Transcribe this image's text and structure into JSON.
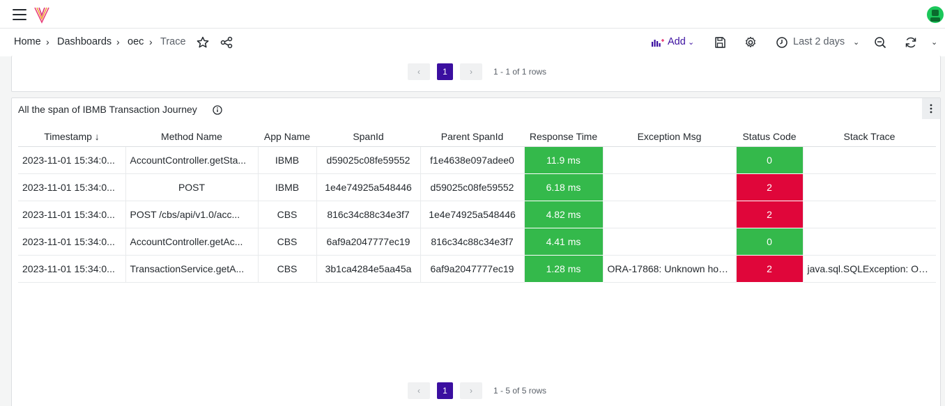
{
  "nav": {
    "breadcrumbs": [
      "Home",
      "Dashboards",
      "oec",
      "Trace"
    ],
    "add_label": "Add",
    "time_range": "Last 2 days"
  },
  "top_panel": {
    "page": "1",
    "rows_info": "1 - 1 of 1 rows"
  },
  "main_panel": {
    "title": "All the span of IBMB Transaction Journey",
    "page": "1",
    "rows_info": "1 - 5 of 5 rows",
    "columns": [
      "Timestamp",
      "Method Name",
      "App Name",
      "SpanId",
      "Parent SpanId",
      "Response Time",
      "Exception Msg",
      "Status Code",
      "Stack Trace"
    ],
    "sort_indicator": "↓",
    "rows": [
      {
        "timestamp": "2023-11-01 15:34:0...",
        "method": "AccountController.getSta...",
        "app": "IBMB",
        "span": "d59025c08fe59552",
        "parent": "f1e4638e097adee0",
        "response": "11.9 ms",
        "exception": "",
        "status": "0",
        "stack": ""
      },
      {
        "timestamp": "2023-11-01 15:34:0...",
        "method": "POST",
        "app": "IBMB",
        "span": "1e4e74925a548446",
        "parent": "d59025c08fe59552",
        "response": "6.18 ms",
        "exception": "",
        "status": "2",
        "stack": ""
      },
      {
        "timestamp": "2023-11-01 15:34:0...",
        "method": "POST /cbs/api/v1.0/acc...",
        "app": "CBS",
        "span": "816c34c88c34e3f7",
        "parent": "1e4e74925a548446",
        "response": "4.82 ms",
        "exception": "",
        "status": "2",
        "stack": ""
      },
      {
        "timestamp": "2023-11-01 15:34:0...",
        "method": "AccountController.getAc...",
        "app": "CBS",
        "span": "6af9a2047777ec19",
        "parent": "816c34c88c34e3f7",
        "response": "4.41 ms",
        "exception": "",
        "status": "0",
        "stack": ""
      },
      {
        "timestamp": "2023-11-01 15:34:0...",
        "method": "TransactionService.getA...",
        "app": "CBS",
        "span": "3b1ca4284e5aa45a",
        "parent": "6af9a2047777ec19",
        "response": "1.28 ms",
        "exception": "ORA-17868: Unknown hos...",
        "status": "2",
        "stack": "java.sql.SQLException: OR..."
      }
    ]
  },
  "colors": {
    "ok": "#34b94b",
    "error": "#e0063a",
    "accent": "#3b0fa0"
  },
  "icons": [
    "menu-icon",
    "logo-icon",
    "user-avatar-icon",
    "star-icon",
    "share-icon",
    "add-panel-icon",
    "chevron-down-icon",
    "save-icon",
    "gear-icon",
    "clock-icon",
    "zoom-out-icon",
    "refresh-icon",
    "info-icon",
    "kebab-icon",
    "chevron-left-icon",
    "chevron-right-icon"
  ]
}
